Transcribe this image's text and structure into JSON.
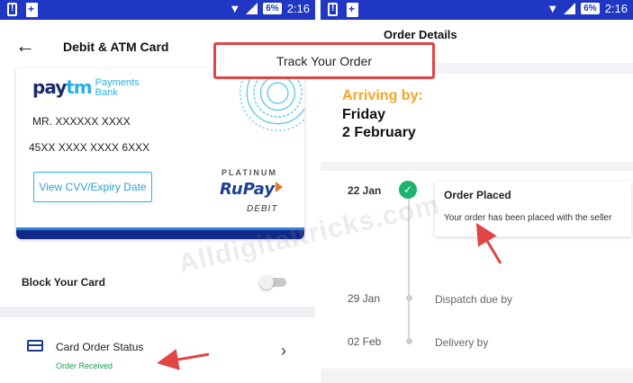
{
  "status_bar": {
    "battery": "6%",
    "time": "2:16"
  },
  "left": {
    "title": "Debit & ATM Card",
    "card": {
      "brand": "paytm",
      "brand_sub": "Payments\nBank",
      "holder": "MR. XXXXXX XXXX",
      "number": "45XX XXXX XXXX 6XXX",
      "cvv_button": "View CVV/Expiry Date",
      "tier": "PLATINUM",
      "network_ru": "Ru",
      "network_pay": "Pay",
      "type": "DEBIT"
    },
    "block_card": {
      "label": "Block Your Card",
      "enabled": false
    },
    "order_status": {
      "title": "Card Order Status",
      "status": "Order Received",
      "status_color": "#1a9a4a"
    }
  },
  "right": {
    "title": "Order Details",
    "arriving_label": "Arriving by:",
    "arriving_day": "Friday",
    "arriving_date": "2 February",
    "timeline": {
      "placed_date": "22 Jan",
      "placed_title": "Order Placed",
      "placed_desc": "Your order has been placed with the seller",
      "dispatch_date": "29 Jan",
      "dispatch_label": "Dispatch due by",
      "delivery_date": "02 Feb",
      "delivery_label": "Delivery by"
    }
  },
  "overlay": {
    "callout": "Track Your Order",
    "watermark": "Alldigitaltricks.com",
    "accent_color": "#e04646"
  }
}
